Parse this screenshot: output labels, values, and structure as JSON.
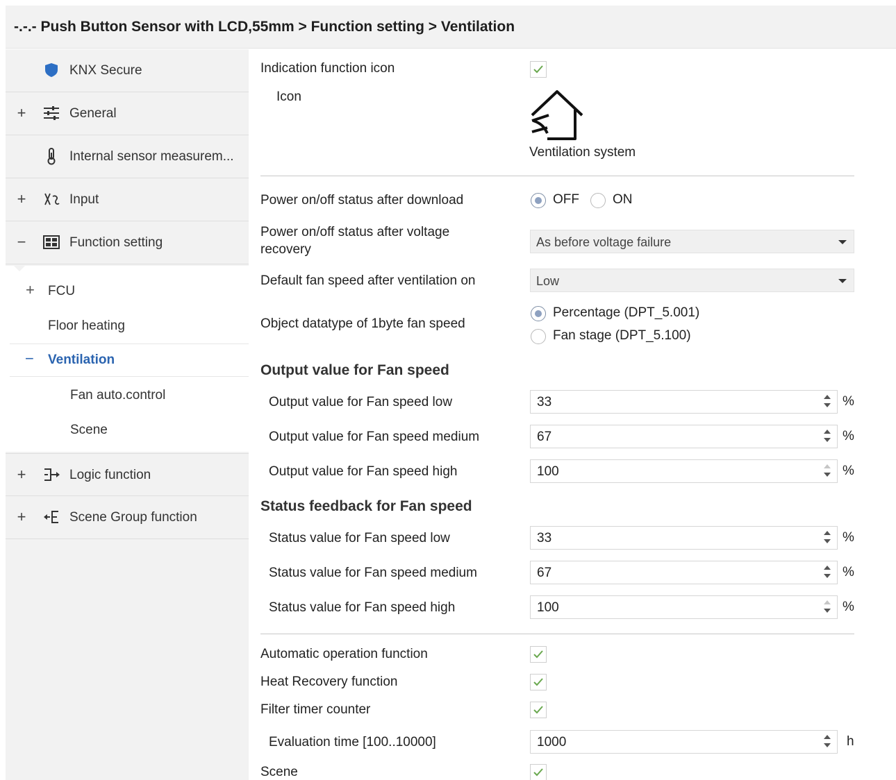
{
  "title": {
    "breadcrumb": "-.-.- Push Button Sensor with LCD,55mm > Function setting > Ventilation"
  },
  "sidebar": {
    "items": [
      {
        "expander": "",
        "icon": "shield-icon",
        "label": "KNX Secure"
      },
      {
        "expander": "+",
        "icon": "sliders-icon",
        "label": "General"
      },
      {
        "expander": "",
        "icon": "thermometer-icon",
        "label": "Internal sensor measurem..."
      },
      {
        "expander": "+",
        "icon": "input-icon",
        "label": "Input"
      },
      {
        "expander": "−",
        "icon": "function-grid-icon",
        "label": "Function setting"
      },
      {
        "expander": "+",
        "icon": "logic-icon",
        "label": "Logic function"
      },
      {
        "expander": "+",
        "icon": "scene-group-icon",
        "label": "Scene Group function"
      }
    ],
    "sub_items": {
      "fcu_expander": "+",
      "fcu": "FCU",
      "floor_heating": "Floor heating",
      "ventilation_expander": "−",
      "ventilation": "Ventilation",
      "fan_auto_control": "Fan auto.control",
      "scene": "Scene"
    },
    "selected_color": "#2b64b0"
  },
  "main": {
    "indication_icon_label": "Indication function icon",
    "indication_icon_checked": true,
    "icon_label": "Icon",
    "icon_name": "ventilation-house-icon",
    "icon_caption": "Ventilation system",
    "power_after_download": {
      "label": "Power on/off status after download",
      "options": [
        "OFF",
        "ON"
      ],
      "selected": "OFF"
    },
    "power_after_recovery": {
      "label_line1": "Power on/off status after voltage",
      "label_line2": "recovery",
      "value": "As before voltage failure"
    },
    "default_fan_speed": {
      "label": "Default fan speed after ventilation on",
      "value": "Low"
    },
    "object_datatype": {
      "label": "Object datatype of 1byte fan speed",
      "options": [
        "Percentage (DPT_5.001)",
        "Fan stage (DPT_5.100)"
      ],
      "selected": "Percentage (DPT_5.001)"
    },
    "output_section": "Output value for Fan speed",
    "output_rows": [
      {
        "label": "Output value for Fan speed low",
        "value": "33",
        "unit": "%"
      },
      {
        "label": "Output value for Fan speed medium",
        "value": "67",
        "unit": "%"
      },
      {
        "label": "Output value for Fan speed high",
        "value": "100",
        "unit": "%"
      }
    ],
    "status_section": "Status feedback for Fan speed",
    "status_rows": [
      {
        "label": "Status value for Fan speed low",
        "value": "33",
        "unit": "%"
      },
      {
        "label": "Status value for Fan speed medium",
        "value": "67",
        "unit": "%"
      },
      {
        "label": "Status value for Fan speed high",
        "value": "100",
        "unit": "%"
      }
    ],
    "automatic_operation": {
      "label": "Automatic operation function",
      "checked": true
    },
    "heat_recovery": {
      "label": "Heat Recovery function",
      "checked": true
    },
    "filter_timer": {
      "label": "Filter timer counter",
      "checked": true
    },
    "evaluation_time": {
      "label": "Evaluation time [100..10000]",
      "value": "1000",
      "unit": "h"
    },
    "scene": {
      "label": "Scene",
      "checked": true
    },
    "check_color": "#6aa84f"
  }
}
